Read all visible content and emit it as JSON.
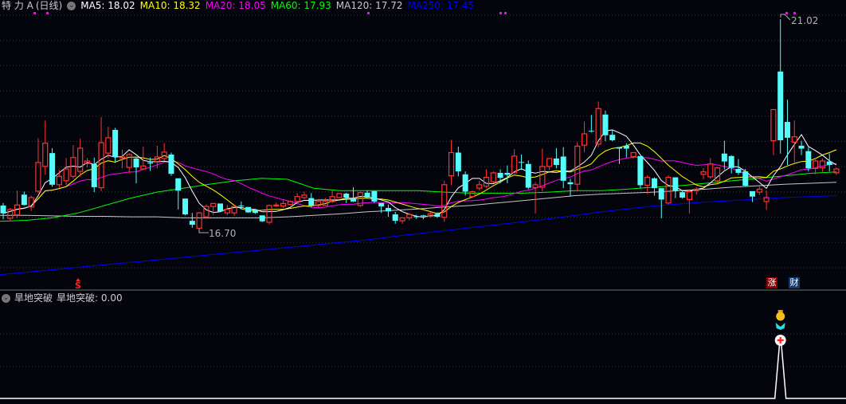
{
  "header": {
    "stock_name": "特 力 A",
    "period": "(日线)",
    "ma_labels": [
      {
        "label": "MA5: 18.02",
        "color": "#ffffff"
      },
      {
        "label": "MA10: 18.32",
        "color": "#ffff00"
      },
      {
        "label": "MA20: 18.05",
        "color": "#ff00ff"
      },
      {
        "label": "MA60: 17.93",
        "color": "#00ff00"
      },
      {
        "label": "MA120: 17.72",
        "color": "#c8c8c8"
      },
      {
        "label": "MA250: 17.45",
        "color": "#0000ff"
      }
    ]
  },
  "indicator": {
    "name": "旱地突破",
    "value_label": "旱地突破: 0.00",
    "signal_icons": [
      "money-bag-icon",
      "butterfly-icon",
      "red-cross-icon"
    ]
  },
  "markers": {
    "s_marker": "S",
    "zhang_tag": "涨",
    "cai_tag": "财"
  },
  "colors": {
    "up": "#ff3232",
    "down": "#54fcfc",
    "background": "#04040c"
  },
  "chart_data": {
    "type": "candlestick",
    "max_label": "21.02",
    "min_label": "16.70",
    "max_price": 21.02,
    "min_price": 16.7,
    "grid": true,
    "candles_ohlc": [
      [
        17.25,
        17.3,
        16.97,
        17.09
      ],
      [
        16.99,
        17.2,
        16.93,
        17.17
      ],
      [
        17.06,
        17.55,
        17.0,
        17.26
      ],
      [
        17.47,
        17.53,
        17.25,
        17.26
      ],
      [
        17.22,
        17.45,
        17.14,
        17.41
      ],
      [
        17.54,
        18.61,
        17.5,
        18.12
      ],
      [
        18.04,
        18.97,
        17.87,
        18.51
      ],
      [
        18.31,
        18.41,
        17.63,
        17.67
      ],
      [
        17.67,
        17.97,
        17.6,
        17.84
      ],
      [
        17.75,
        18.21,
        17.66,
        17.99
      ],
      [
        17.84,
        18.47,
        17.79,
        18.22
      ],
      [
        17.94,
        18.6,
        17.83,
        18.41
      ],
      [
        18.1,
        18.21,
        18.02,
        18.15
      ],
      [
        18.09,
        18.22,
        17.52,
        17.62
      ],
      [
        17.61,
        19.04,
        17.54,
        18.52
      ],
      [
        18.31,
        18.84,
        18.2,
        18.62
      ],
      [
        18.78,
        18.82,
        18.11,
        18.23
      ],
      [
        18.22,
        18.38,
        18.0,
        18.23
      ],
      [
        18.02,
        18.31,
        17.91,
        18.28
      ],
      [
        18.2,
        18.22,
        17.7,
        18.02
      ],
      [
        17.99,
        18.44,
        17.97,
        18.05
      ],
      [
        18.12,
        18.22,
        17.95,
        18.1
      ],
      [
        18.13,
        18.46,
        18.0,
        18.23
      ],
      [
        18.2,
        18.51,
        18.15,
        18.33
      ],
      [
        18.28,
        18.32,
        17.85,
        17.89
      ],
      [
        17.8,
        17.8,
        17.17,
        17.55
      ],
      [
        17.39,
        17.39,
        17.05,
        17.07
      ],
      [
        16.94,
        17.1,
        16.8,
        16.86
      ],
      [
        16.79,
        17.12,
        16.7,
        17.1
      ],
      [
        17.02,
        17.27,
        16.99,
        17.23
      ],
      [
        17.23,
        17.3,
        17.06,
        17.29
      ],
      [
        17.29,
        17.29,
        17.13,
        17.13
      ],
      [
        17.1,
        17.26,
        17.05,
        17.17
      ],
      [
        17.1,
        17.26,
        17.04,
        17.23
      ],
      [
        17.25,
        17.33,
        17.17,
        17.24
      ],
      [
        17.22,
        17.22,
        17.1,
        17.11
      ],
      [
        17.17,
        17.17,
        17.08,
        17.1
      ],
      [
        17.05,
        17.05,
        16.91,
        16.93
      ],
      [
        16.91,
        17.27,
        16.87,
        17.25
      ],
      [
        17.24,
        17.31,
        17.22,
        17.26
      ],
      [
        17.24,
        17.38,
        17.2,
        17.29
      ],
      [
        17.27,
        17.35,
        17.25,
        17.33
      ],
      [
        17.33,
        17.5,
        17.3,
        17.43
      ],
      [
        17.41,
        17.53,
        17.38,
        17.46
      ],
      [
        17.4,
        17.5,
        17.21,
        17.25
      ],
      [
        17.25,
        17.38,
        17.21,
        17.33
      ],
      [
        17.25,
        17.4,
        17.24,
        17.33
      ],
      [
        17.33,
        17.56,
        17.3,
        17.43
      ],
      [
        17.41,
        17.5,
        17.4,
        17.49
      ],
      [
        17.49,
        17.51,
        17.3,
        17.41
      ],
      [
        17.39,
        17.62,
        17.32,
        17.33
      ],
      [
        17.25,
        17.53,
        17.22,
        17.51
      ],
      [
        17.51,
        17.55,
        17.4,
        17.41
      ],
      [
        17.54,
        17.55,
        17.3,
        17.33
      ],
      [
        17.3,
        17.3,
        17.1,
        17.23
      ],
      [
        17.2,
        17.27,
        17.02,
        17.13
      ],
      [
        17.07,
        17.12,
        16.88,
        16.94
      ],
      [
        16.94,
        17.0,
        16.88,
        17.0
      ],
      [
        17.0,
        17.1,
        16.95,
        17.07
      ],
      [
        17.03,
        17.06,
        16.98,
        17.02
      ],
      [
        17.05,
        17.06,
        16.97,
        17.04
      ],
      [
        17.03,
        17.12,
        17.0,
        17.08
      ],
      [
        17.08,
        17.11,
        17.0,
        17.02
      ],
      [
        17.01,
        17.75,
        16.92,
        17.67
      ],
      [
        17.85,
        18.58,
        17.66,
        18.32
      ],
      [
        18.32,
        18.44,
        17.84,
        17.94
      ],
      [
        17.88,
        17.94,
        17.45,
        17.53
      ],
      [
        17.43,
        17.55,
        17.4,
        17.53
      ],
      [
        17.6,
        17.75,
        17.55,
        17.67
      ],
      [
        17.64,
        17.98,
        17.6,
        17.82
      ],
      [
        17.73,
        17.94,
        17.7,
        17.91
      ],
      [
        17.91,
        17.98,
        17.7,
        17.81
      ],
      [
        17.91,
        18.06,
        17.7,
        17.87
      ],
      [
        17.91,
        18.39,
        17.9,
        18.25
      ],
      [
        18.13,
        18.28,
        17.97,
        18.12
      ],
      [
        18.09,
        18.16,
        17.58,
        17.61
      ],
      [
        17.61,
        17.72,
        17.09,
        17.67
      ],
      [
        17.62,
        18.4,
        17.54,
        18.04
      ],
      [
        18.04,
        18.2,
        17.96,
        18.2
      ],
      [
        18.2,
        18.41,
        18.0,
        18.07
      ],
      [
        18.24,
        18.43,
        17.6,
        17.75
      ],
      [
        17.72,
        17.79,
        17.43,
        17.68
      ],
      [
        17.68,
        18.53,
        17.55,
        18.45
      ],
      [
        18.47,
        18.95,
        18.33,
        18.7
      ],
      [
        18.76,
        19.08,
        18.73,
        18.75
      ],
      [
        18.49,
        19.35,
        18.43,
        19.21
      ],
      [
        19.09,
        19.17,
        18.55,
        18.67
      ],
      [
        18.68,
        18.78,
        18.55,
        18.57
      ],
      [
        18.43,
        18.43,
        18.09,
        18.4
      ],
      [
        18.46,
        18.51,
        18.22,
        18.4
      ],
      [
        18.24,
        18.32,
        18.2,
        18.32
      ],
      [
        18.25,
        18.25,
        17.6,
        17.66
      ],
      [
        17.66,
        17.86,
        17.48,
        17.82
      ],
      [
        17.8,
        17.82,
        17.45,
        17.6
      ],
      [
        17.6,
        17.6,
        16.99,
        17.37
      ],
      [
        17.3,
        17.86,
        17.27,
        17.82
      ],
      [
        17.82,
        17.82,
        17.4,
        17.55
      ],
      [
        17.52,
        17.55,
        17.39,
        17.41
      ],
      [
        17.37,
        17.55,
        17.09,
        17.53
      ],
      [
        17.55,
        17.62,
        17.47,
        17.58
      ],
      [
        17.88,
        18.01,
        17.78,
        17.93
      ],
      [
        17.83,
        18.21,
        17.79,
        18.09
      ],
      [
        17.75,
        18.03,
        17.7,
        18.01
      ],
      [
        18.3,
        18.56,
        17.98,
        18.14
      ],
      [
        18.25,
        18.27,
        17.9,
        18.01
      ],
      [
        17.99,
        18.19,
        17.87,
        17.91
      ],
      [
        17.94,
        17.99,
        17.63,
        17.65
      ],
      [
        17.54,
        17.54,
        17.32,
        17.43
      ],
      [
        17.52,
        17.65,
        17.46,
        17.58
      ],
      [
        17.33,
        17.56,
        17.16,
        17.41
      ],
      [
        18.56,
        19.19,
        18.27,
        19.19
      ],
      [
        19.96,
        21.02,
        18.3,
        18.57
      ],
      [
        18.94,
        19.39,
        18.07,
        18.62
      ],
      [
        18.53,
        18.97,
        18.12,
        18.64
      ],
      [
        18.46,
        18.56,
        18.27,
        18.4
      ],
      [
        18.35,
        18.43,
        17.94,
        18.0
      ],
      [
        18.0,
        18.2,
        17.88,
        18.15
      ],
      [
        18.01,
        18.2,
        17.93,
        18.15
      ],
      [
        18.14,
        18.3,
        17.94,
        18.07
      ],
      [
        17.91,
        18.02,
        17.87,
        17.99
      ]
    ],
    "ma_long": {
      "MA60": [
        16.93,
        16.95,
        17.0,
        17.1,
        17.25,
        17.4,
        17.52,
        17.6,
        17.68,
        17.75,
        17.8,
        17.78,
        17.6,
        17.55,
        17.55,
        17.55,
        17.55,
        17.52,
        17.5,
        17.5,
        17.5,
        17.52,
        17.55,
        17.55,
        17.58,
        17.62,
        17.65,
        17.7,
        17.75,
        17.8,
        17.85,
        17.9,
        17.93
      ],
      "MA120": [
        17.05,
        17.05,
        17.04,
        17.03,
        17.03,
        17.02,
        17.02,
        17.0,
        17.0,
        17.0,
        17.0,
        17.02,
        17.05,
        17.08,
        17.12,
        17.15,
        17.18,
        17.22,
        17.25,
        17.3,
        17.35,
        17.4,
        17.45,
        17.48,
        17.5,
        17.52,
        17.55,
        17.58,
        17.62,
        17.65,
        17.68,
        17.7,
        17.72
      ],
      "MA250": [
        15.85,
        15.9,
        15.95,
        16.0,
        16.05,
        16.1,
        16.15,
        16.2,
        16.25,
        16.3,
        16.35,
        16.4,
        16.45,
        16.5,
        16.55,
        16.62,
        16.68,
        16.74,
        16.8,
        16.86,
        16.92,
        16.98,
        17.05,
        17.12,
        17.18,
        17.24,
        17.28,
        17.32,
        17.35,
        17.38,
        17.41,
        17.43,
        17.45
      ]
    },
    "indicator_signal_index": 111
  }
}
